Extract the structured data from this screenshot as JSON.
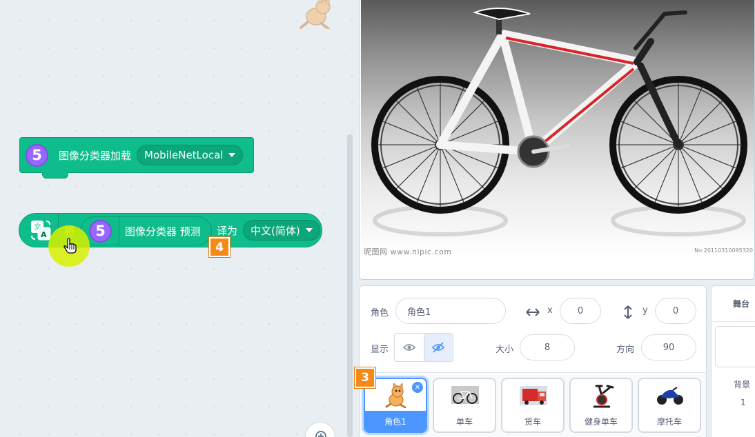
{
  "code_area": {
    "load_block": {
      "extension_number": "5",
      "label": "图像分类器加载",
      "model_value": "MobileNetLocal"
    },
    "translate_block": {
      "word_translate": "将",
      "reporter": {
        "extension_number": "5",
        "label": "图像分类器 预测"
      },
      "translate_to": "译为",
      "language_value": "中文(简体)"
    },
    "step_badges": {
      "four": "4",
      "three": "3"
    }
  },
  "stage": {
    "watermark": "昵图网 www.nipic.com",
    "watermark_id": "No:20110310095320"
  },
  "sprite_info": {
    "sprite_label": "角色",
    "sprite_name": "角色1",
    "x_label": "x",
    "x_value": "0",
    "y_label": "y",
    "y_value": "0",
    "show_label": "显示",
    "size_label": "大小",
    "size_value": "8",
    "direction_label": "方向",
    "direction_value": "90"
  },
  "sprites": [
    {
      "name": "角色1",
      "selected": true,
      "icon": "cat-icon"
    },
    {
      "name": "单车",
      "selected": false,
      "icon": "bicycle-icon"
    },
    {
      "name": "货车",
      "selected": false,
      "icon": "truck-icon"
    },
    {
      "name": "健身单车",
      "selected": false,
      "icon": "exercise-bike-icon"
    },
    {
      "name": "摩托车",
      "selected": false,
      "icon": "motorcycle-icon"
    }
  ],
  "stage_pane": {
    "title": "舞台",
    "backdrop_label": "背景",
    "backdrop_count": "1"
  },
  "colors": {
    "extension_green": "#0fbd8c",
    "extension_purple": "#9966ff",
    "step_badge_orange": "#f58a18",
    "selection_blue": "#4c97ff"
  }
}
